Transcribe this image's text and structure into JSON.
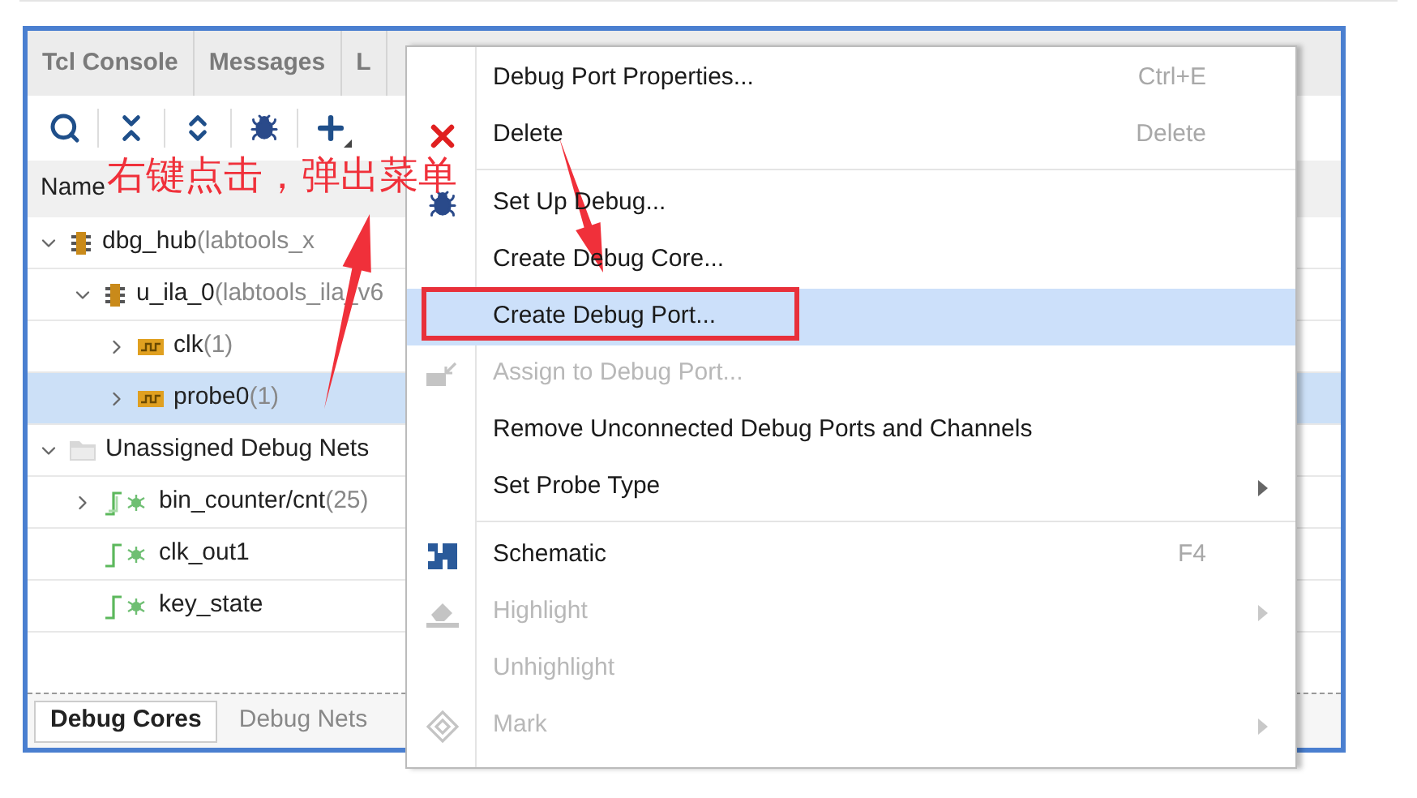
{
  "panel_tabs": [
    {
      "label": "Tcl Console"
    },
    {
      "label": "Messages"
    },
    {
      "label": "L"
    }
  ],
  "tree": {
    "column": "Name",
    "nodes": [
      {
        "kind": "core",
        "name": "dbg_hub",
        "detail": "(labtools_x",
        "expanded": true,
        "selected": false,
        "children": [
          {
            "kind": "core",
            "name": "u_ila_0",
            "detail": "(labtools_ila_v6",
            "expanded": true,
            "selected": false,
            "children": [
              {
                "kind": "port",
                "name": "clk",
                "detail": "(1)",
                "expanded": false,
                "selected": false
              },
              {
                "kind": "port",
                "name": "probe0",
                "detail": "(1)",
                "expanded": false,
                "selected": true
              }
            ]
          }
        ]
      },
      {
        "kind": "folder",
        "name": "Unassigned Debug Nets",
        "expanded": true,
        "selected": false,
        "children": [
          {
            "kind": "bus",
            "name": "bin_counter/cnt",
            "detail": "(25)",
            "expanded": false,
            "selected": false
          },
          {
            "kind": "net",
            "name": "clk_out1",
            "selected": false
          },
          {
            "kind": "net",
            "name": "key_state",
            "selected": false
          }
        ]
      }
    ]
  },
  "bottom_tabs": [
    {
      "label": "Debug Cores",
      "selected": true
    },
    {
      "label": "Debug Nets",
      "selected": false
    }
  ],
  "context_menu": [
    {
      "kind": "item",
      "label": "Debug Port Properties...",
      "shortcut": "Ctrl+E",
      "disabled": false,
      "selected": false
    },
    {
      "kind": "item",
      "label": "Delete",
      "shortcut": "Delete",
      "disabled": false,
      "selected": false
    },
    {
      "kind": "separator"
    },
    {
      "kind": "item",
      "label": "Set Up Debug...",
      "disabled": false,
      "selected": false
    },
    {
      "kind": "item",
      "label": "Create Debug Core...",
      "disabled": false,
      "selected": false
    },
    {
      "kind": "item",
      "label": "Create Debug Port...",
      "disabled": false,
      "selected": true
    },
    {
      "kind": "item",
      "label": "Assign to Debug Port...",
      "disabled": true,
      "selected": false
    },
    {
      "kind": "item",
      "label": "Remove Unconnected Debug Ports and Channels",
      "disabled": false,
      "selected": false
    },
    {
      "kind": "item",
      "label": "Set Probe Type",
      "disabled": false,
      "selected": false,
      "submenu": true
    },
    {
      "kind": "separator"
    },
    {
      "kind": "item",
      "label": "Schematic",
      "shortcut": "F4",
      "disabled": false,
      "selected": false
    },
    {
      "kind": "item",
      "label": "Highlight",
      "disabled": true,
      "selected": false,
      "submenu": true
    },
    {
      "kind": "item",
      "label": "Unhighlight",
      "disabled": true,
      "selected": false
    },
    {
      "kind": "item",
      "label": "Mark",
      "disabled": true,
      "selected": false,
      "submenu": true
    }
  ],
  "annotation": {
    "text": "右键点击，弹出菜单"
  }
}
